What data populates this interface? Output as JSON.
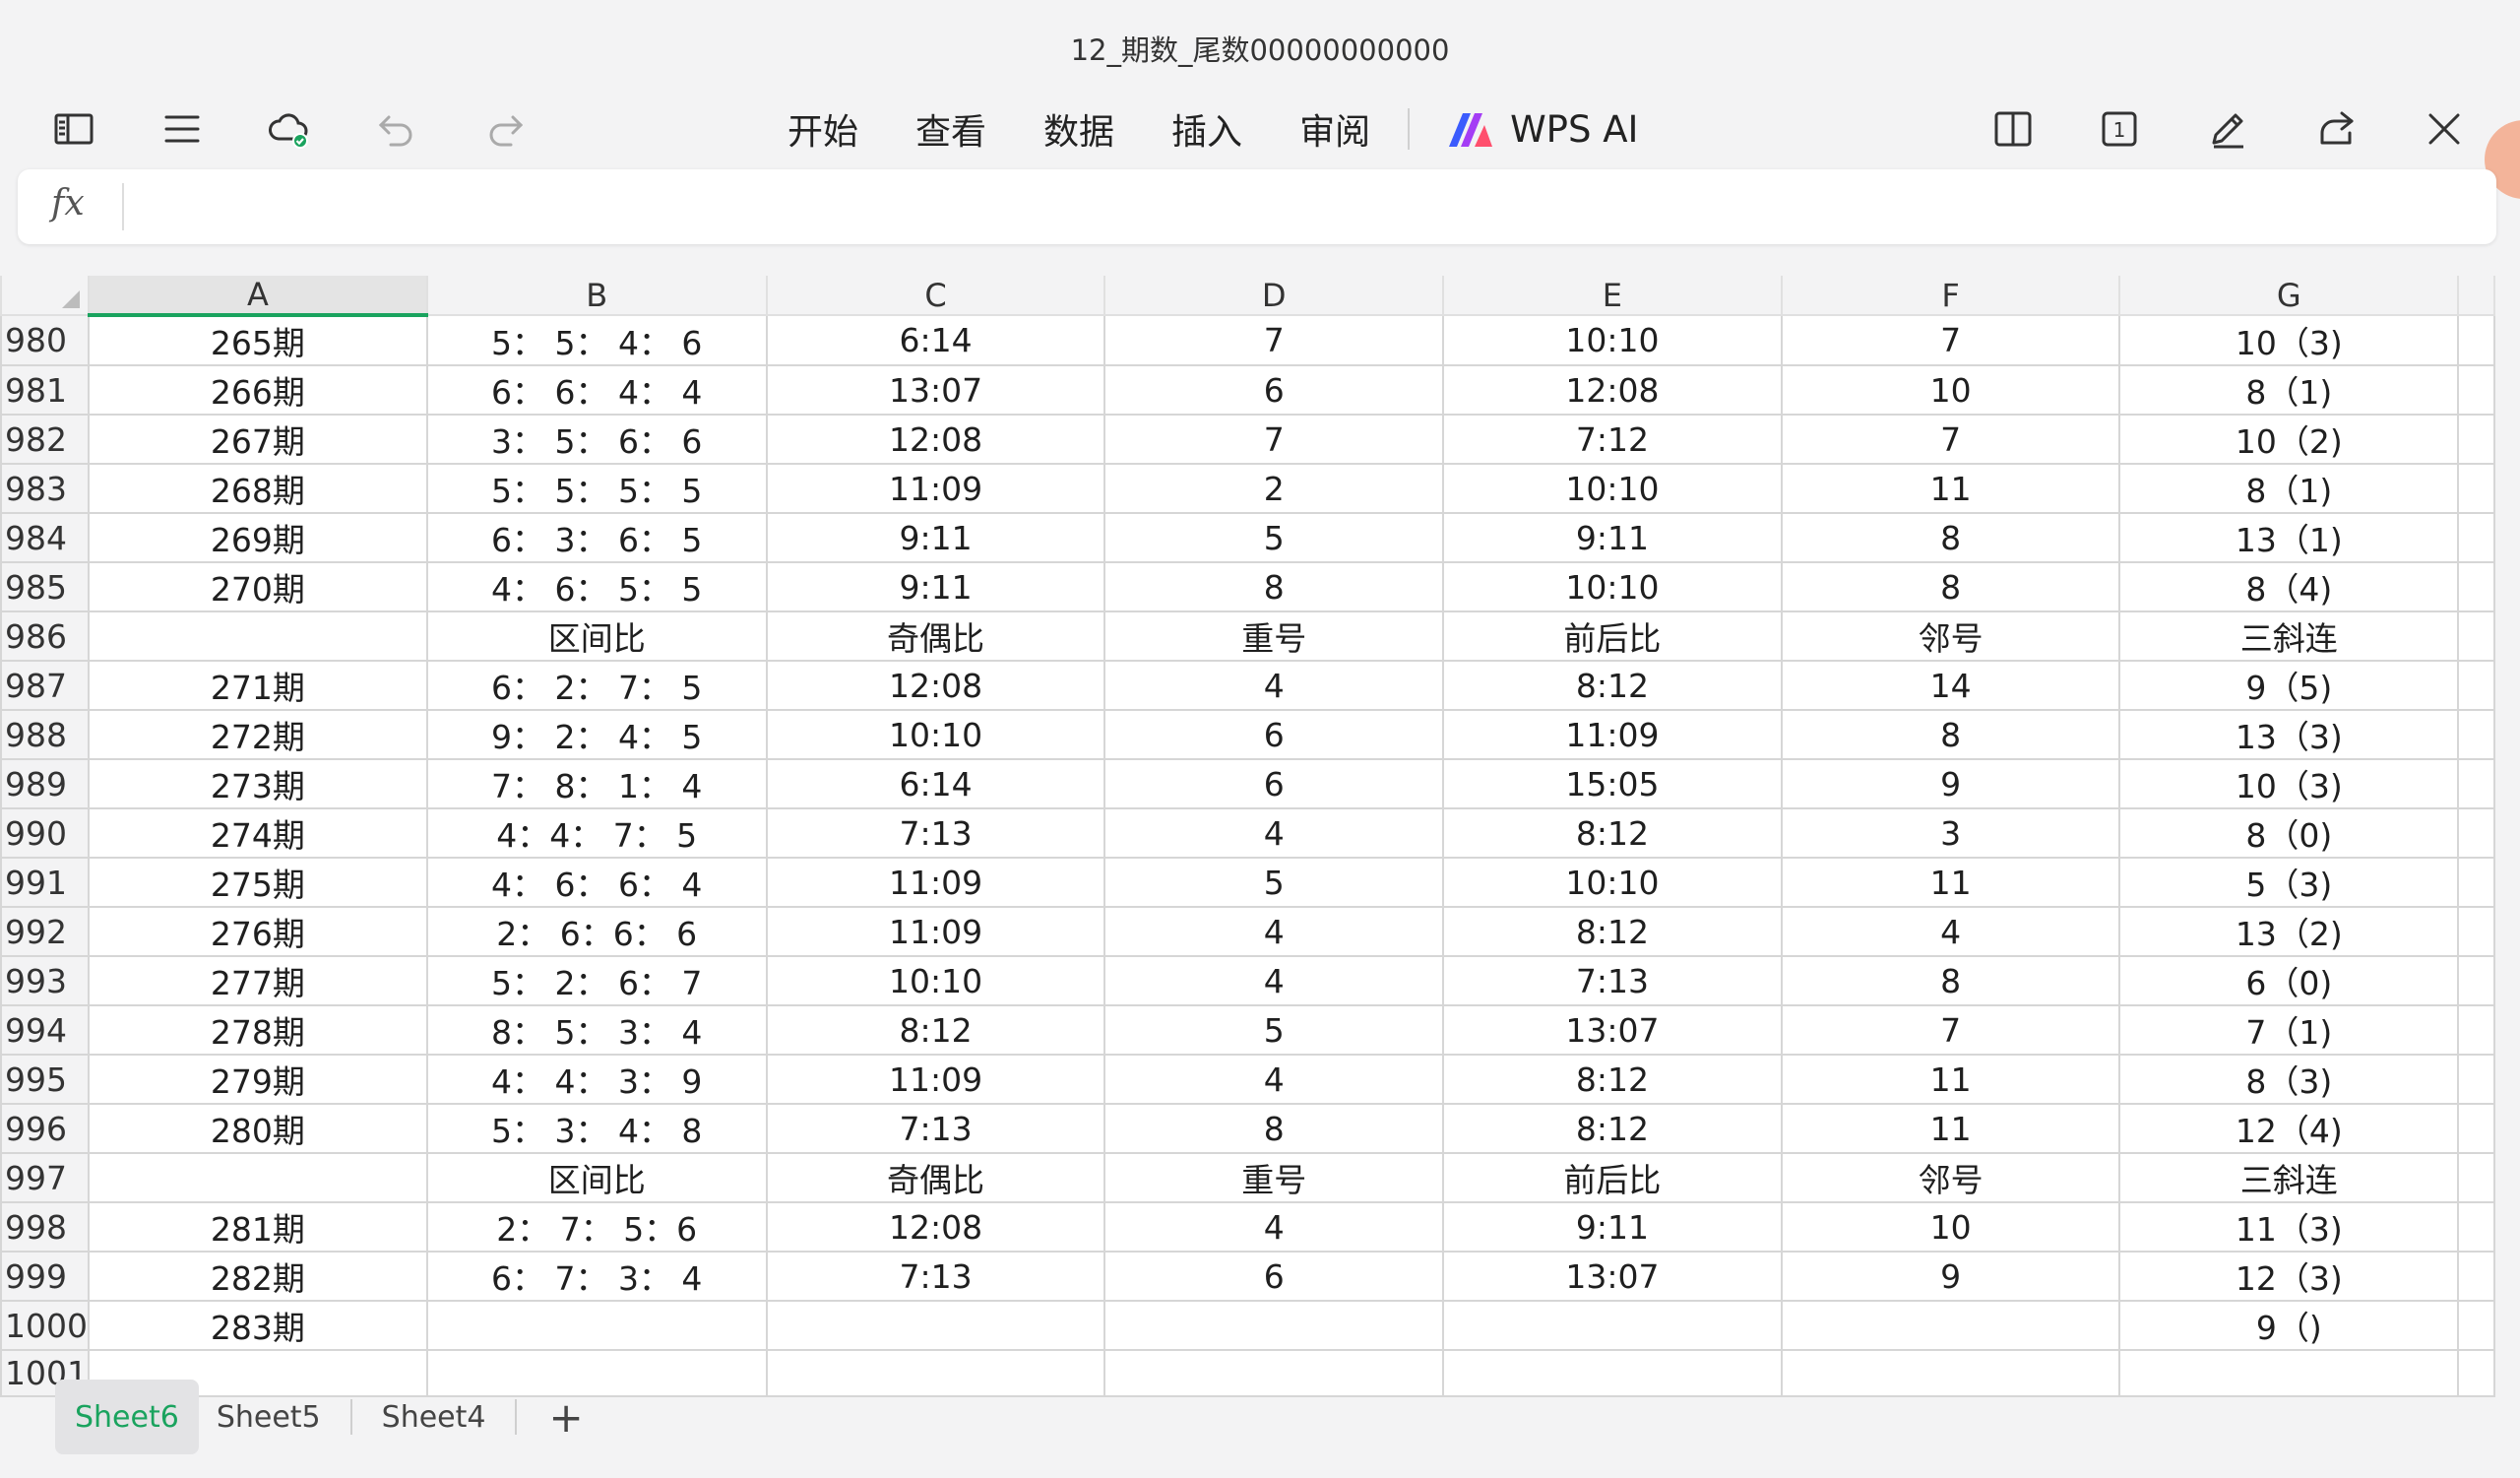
{
  "document": {
    "title": "12_期数_尾数00000000000"
  },
  "toolbar": {
    "menu": [
      "开始",
      "查看",
      "数据",
      "插入",
      "审阅"
    ],
    "ai_label": "WPS AI",
    "page_count_label": "1",
    "accent_color": "#1aa35e"
  },
  "formula_bar": {
    "fx_label": "fx",
    "value": ""
  },
  "sheet": {
    "column_headers": [
      "A",
      "B",
      "C",
      "D",
      "E",
      "F",
      "G"
    ],
    "rows": [
      {
        "num": "980",
        "cells": [
          "265期",
          "5： 5： 4： 6",
          "6:14",
          "7",
          "10:10",
          "7",
          "10（3)"
        ]
      },
      {
        "num": "981",
        "cells": [
          "266期",
          "6： 6： 4： 4",
          "13:07",
          "6",
          "12:08",
          "10",
          "8（1)"
        ]
      },
      {
        "num": "982",
        "cells": [
          "267期",
          "3： 5： 6： 6",
          "12:08",
          "7",
          "7:12",
          "7",
          "10（2)"
        ]
      },
      {
        "num": "983",
        "cells": [
          "268期",
          "5： 5： 5： 5",
          "11:09",
          "2",
          "10:10",
          "11",
          "8（1)"
        ]
      },
      {
        "num": "984",
        "cells": [
          "269期",
          "6： 3： 6： 5",
          "9:11",
          "5",
          "9:11",
          "8",
          "13（1)"
        ]
      },
      {
        "num": "985",
        "cells": [
          "270期",
          "4： 6： 5： 5",
          "9:11",
          "8",
          "10:10",
          "8",
          "8（4)"
        ]
      },
      {
        "num": "986",
        "cells": [
          "",
          "区间比",
          "奇偶比",
          "重号",
          "前后比",
          "邻号",
          "三斜连"
        ]
      },
      {
        "num": "987",
        "cells": [
          "271期",
          "6： 2： 7： 5",
          "12:08",
          "4",
          "8:12",
          "14",
          "9（5)"
        ]
      },
      {
        "num": "988",
        "cells": [
          "272期",
          "9： 2： 4： 5",
          "10:10",
          "6",
          "11:09",
          "8",
          "13（3)"
        ]
      },
      {
        "num": "989",
        "cells": [
          "273期",
          "7： 8： 1： 4",
          "6:14",
          "6",
          "15:05",
          "9",
          "10（3)"
        ]
      },
      {
        "num": "990",
        "cells": [
          "274期",
          "4：4： 7： 5",
          "7:13",
          "4",
          "8:12",
          "3",
          "8（0)"
        ]
      },
      {
        "num": "991",
        "cells": [
          "275期",
          "4： 6： 6： 4",
          "11:09",
          "5",
          "10:10",
          "11",
          "5（3)"
        ]
      },
      {
        "num": "992",
        "cells": [
          "276期",
          "2： 6：6： 6",
          "11:09",
          "4",
          "8:12",
          "4",
          "13（2)"
        ]
      },
      {
        "num": "993",
        "cells": [
          "277期",
          "5： 2： 6： 7",
          "10:10",
          "4",
          "7:13",
          "8",
          "6（0)"
        ]
      },
      {
        "num": "994",
        "cells": [
          "278期",
          "8： 5： 3： 4",
          "8:12",
          "5",
          "13:07",
          "7",
          "7（1)"
        ]
      },
      {
        "num": "995",
        "cells": [
          "279期",
          "4： 4： 3： 9",
          "11:09",
          "4",
          "8:12",
          "11",
          "8（3)"
        ]
      },
      {
        "num": "996",
        "cells": [
          "280期",
          "5： 3： 4： 8",
          "7:13",
          "8",
          "8:12",
          "11",
          "12（4)"
        ]
      },
      {
        "num": "997",
        "cells": [
          "",
          "区间比",
          "奇偶比",
          "重号",
          "前后比",
          "邻号",
          "三斜连"
        ]
      },
      {
        "num": "998",
        "cells": [
          "281期",
          "2： 7： 5：6",
          "12:08",
          "4",
          "9:11",
          "10",
          "11（3)"
        ]
      },
      {
        "num": "999",
        "cells": [
          "282期",
          "6： 7： 3： 4",
          "7:13",
          "6",
          "13:07",
          "9",
          "12（3)"
        ]
      },
      {
        "num": "1000",
        "cells": [
          "283期",
          "",
          "",
          "",
          "",
          "",
          "9（)"
        ]
      },
      {
        "num": "1001",
        "cells": [
          "",
          "",
          "",
          "",
          "",
          "",
          ""
        ]
      }
    ]
  },
  "sheet_tabs": [
    {
      "label": "Sheet6",
      "active": true
    },
    {
      "label": "Sheet5",
      "active": false
    },
    {
      "label": "Sheet4",
      "active": false
    }
  ],
  "add_sheet_label": "+"
}
